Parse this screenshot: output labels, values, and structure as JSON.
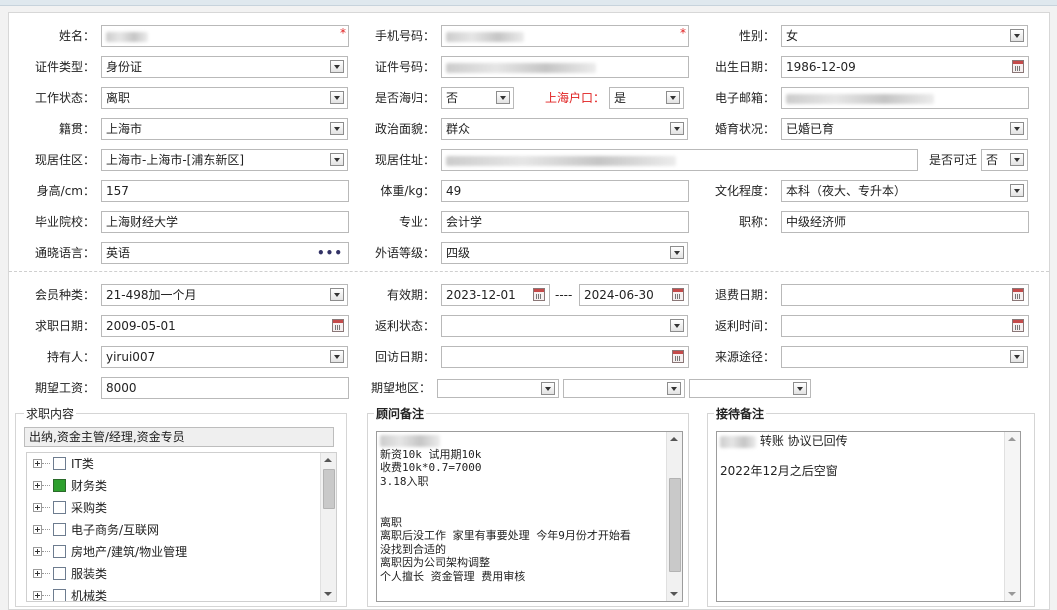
{
  "colors": {
    "required": "#e02020",
    "checked": "#2ea02e",
    "panel_border": "#d7d7d7"
  },
  "icons": {
    "dropdown": "chevron-down-icon",
    "calendar": "calendar-icon",
    "more": "ellipsis-icon",
    "expand": "plus-icon",
    "required": "asterisk-icon"
  },
  "personal": {
    "name": {
      "label": "姓名：",
      "value": ""
    },
    "phone": {
      "label": "手机号码：",
      "value": ""
    },
    "gender": {
      "label": "性别：",
      "value": "女"
    },
    "id_type": {
      "label": "证件类型：",
      "value": "身份证"
    },
    "id_number": {
      "label": "证件号码：",
      "value": ""
    },
    "birth_date": {
      "label": "出生日期：",
      "value": "1986-12-09"
    },
    "work_status": {
      "label": "工作状态：",
      "value": "离职"
    },
    "returnee": {
      "label": "是否海归：",
      "value": "否"
    },
    "shanghai_hukou": {
      "label": "上海户口：",
      "value": "是"
    },
    "email": {
      "label": "电子邮箱：",
      "value": ""
    },
    "native_place": {
      "label": "籍贯：",
      "value": "上海市"
    },
    "political": {
      "label": "政治面貌：",
      "value": "群众"
    },
    "marital": {
      "label": "婚育状况：",
      "value": "已婚已育"
    },
    "residence_area": {
      "label": "现居住区：",
      "value": "上海市-上海市-[浦东新区]"
    },
    "address": {
      "label": "现居住址：",
      "value": ""
    },
    "relocate": {
      "label": "是否可迁",
      "value": "否"
    },
    "height": {
      "label": "身高/cm：",
      "value": "157"
    },
    "weight": {
      "label": "体重/kg：",
      "value": "49"
    },
    "education": {
      "label": "文化程度：",
      "value": "本科（夜大、专升本）"
    },
    "school": {
      "label": "毕业院校：",
      "value": "上海财经大学"
    },
    "major": {
      "label": "专业：",
      "value": "会计学"
    },
    "title": {
      "label": "职称：",
      "value": "中级经济师"
    },
    "language": {
      "label": "通晓语言：",
      "value": "英语"
    },
    "lang_level": {
      "label": "外语等级：",
      "value": "四级"
    }
  },
  "membership": {
    "member_type": {
      "label": "会员种类：",
      "value": "21-498加一个月"
    },
    "valid": {
      "label": "有效期：",
      "from": "2023-12-01",
      "sep": "----",
      "to": "2024-06-30"
    },
    "refund_date": {
      "label": "退费日期：",
      "value": ""
    },
    "job_date": {
      "label": "求职日期：",
      "value": "2009-05-01"
    },
    "rebate_status": {
      "label": "返利状态：",
      "value": ""
    },
    "rebate_time": {
      "label": "返利时间：",
      "value": ""
    },
    "holder": {
      "label": "持有人：",
      "value": "yirui007"
    },
    "visit_date": {
      "label": "回访日期：",
      "value": ""
    },
    "source": {
      "label": "来源途径：",
      "value": ""
    },
    "expected_salary": {
      "label": "期望工资：",
      "value": "8000"
    },
    "expected_region": {
      "label": "期望地区：",
      "values": [
        "",
        "",
        ""
      ]
    }
  },
  "job_content": {
    "title": "求职内容",
    "selected": "出纳,资金主管/经理,资金专员",
    "tree": [
      {
        "label": "IT类",
        "checked": false
      },
      {
        "label": "财务类",
        "checked": true
      },
      {
        "label": "采购类",
        "checked": false
      },
      {
        "label": "电子商务/互联网",
        "checked": false
      },
      {
        "label": "房地产/建筑/物业管理",
        "checked": false
      },
      {
        "label": "服装类",
        "checked": false
      },
      {
        "label": "机械类",
        "checked": false
      }
    ]
  },
  "advisor_notes": {
    "title": "顾问备注",
    "lines": [
      "",
      "新资10k  试用期10k",
      "收费10k*0.7=7000",
      "3.18入职",
      "",
      "",
      "离职",
      "离职后没工作 家里有事要处理  今年9月份才开始看",
      "没找到合适的",
      "离职因为公司架构调整",
      "个人擅长  资金管理 费用审核"
    ]
  },
  "reception_notes": {
    "title": "接待备注",
    "line1": "转账 协议已回传",
    "line2": "2022年12月之后空窗"
  }
}
